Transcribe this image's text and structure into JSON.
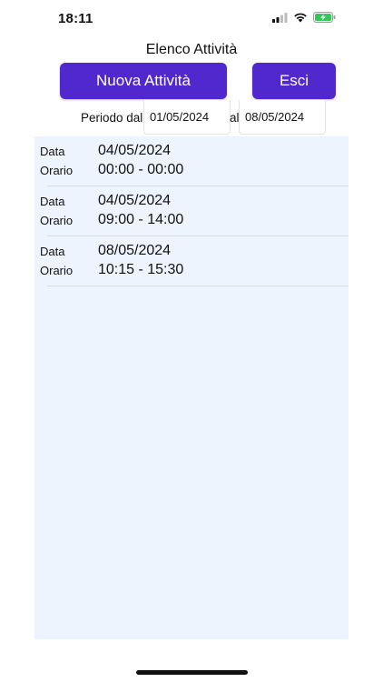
{
  "status_bar": {
    "time": "18:11"
  },
  "header": {
    "title": "Elenco Attività"
  },
  "buttons": {
    "new_activity": "Nuova Attività",
    "exit": "Esci"
  },
  "period": {
    "label_from": "Periodo dal",
    "from_value": "01/05/2024",
    "label_to": "al",
    "to_value": "08/05/2024"
  },
  "activities": [
    {
      "date_label": "Data",
      "date": "04/05/2024",
      "time_label": "Orario",
      "time": "00:00 - 00:00"
    },
    {
      "date_label": "Data",
      "date": "04/05/2024",
      "time_label": "Orario",
      "time": "09:00 - 14:00"
    },
    {
      "date_label": "Data",
      "date": "08/05/2024",
      "time_label": "Orario",
      "time": "10:15 - 15:30"
    }
  ],
  "icons": [
    "cellular-signal-icon",
    "wifi-icon",
    "battery-charging-icon"
  ],
  "colors": {
    "accent": "#5128cd",
    "list_background": "#eef4fd",
    "battery": "#34c759"
  }
}
